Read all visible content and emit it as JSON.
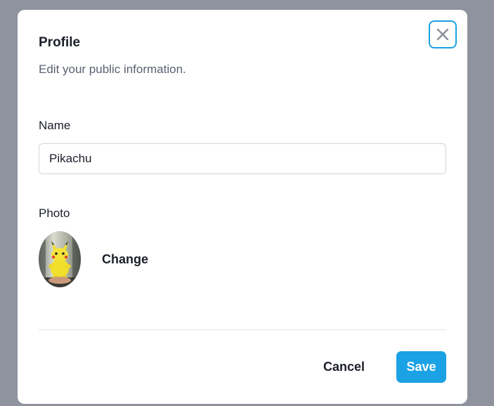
{
  "dialog": {
    "title": "Profile",
    "subtitle": "Edit your public information.",
    "close_icon": "close-icon"
  },
  "form": {
    "name_label": "Name",
    "name_value": "Pikachu",
    "photo_label": "Photo",
    "change_label": "Change"
  },
  "footer": {
    "cancel_label": "Cancel",
    "save_label": "Save"
  },
  "colors": {
    "accent": "#1ba2e4",
    "overlay": "#8f939e",
    "text": "#1b1f29",
    "muted_text": "#5b6171"
  }
}
